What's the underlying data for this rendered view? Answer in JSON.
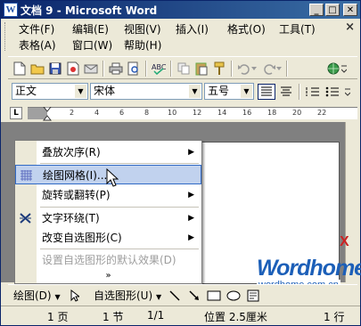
{
  "window": {
    "app_icon_letter": "W",
    "title": "文档 9 - Microsoft Word",
    "buttons": {
      "minimize": "_",
      "maximize": "□",
      "close": "✕"
    },
    "doc_close": "×"
  },
  "menubar": {
    "items": [
      {
        "label": "文件(F)"
      },
      {
        "label": "编辑(E)"
      },
      {
        "label": "视图(V)"
      },
      {
        "label": "插入(I)"
      },
      {
        "label": "格式(O)"
      },
      {
        "label": "工具(T)"
      },
      {
        "label": "表格(A)"
      },
      {
        "label": "窗口(W)"
      },
      {
        "label": "帮助(H)"
      }
    ]
  },
  "format": {
    "style": "正文",
    "font": "宋体",
    "size": "五号"
  },
  "ruler": {
    "tab_selector": "L",
    "ticks": [
      "2",
      "4",
      "6",
      "8",
      "10",
      "12",
      "14",
      "16",
      "18",
      "20",
      "22"
    ]
  },
  "popup": {
    "items": [
      {
        "label": "叠放次序(R)",
        "submenu": true
      },
      {
        "label": "绘图网格(I)...",
        "highlighted": true,
        "icon": "grid-icon"
      },
      {
        "label": "旋转或翻转(P)",
        "submenu": true
      },
      {
        "label": "文字环绕(T)",
        "submenu": true,
        "icon": "text-wrap-icon"
      },
      {
        "label": "改变自选图形(C)",
        "submenu": true
      },
      {
        "label": "设置自选图形的默认效果(D)",
        "disabled": true
      }
    ],
    "expand": "»",
    "submenu_glyph": "▶"
  },
  "drawing_toolbar": {
    "draw_label": "绘图(D)",
    "autoshape_label": "自选图形(U)"
  },
  "statusbar": {
    "page": "1 页",
    "section": "1 节",
    "page_of": "1/1",
    "position": "位置 2.5厘米",
    "line": "1 行"
  },
  "watermark": {
    "brand": "Wordhome",
    "url": "wordhome.com.cn",
    "logo": "X"
  }
}
